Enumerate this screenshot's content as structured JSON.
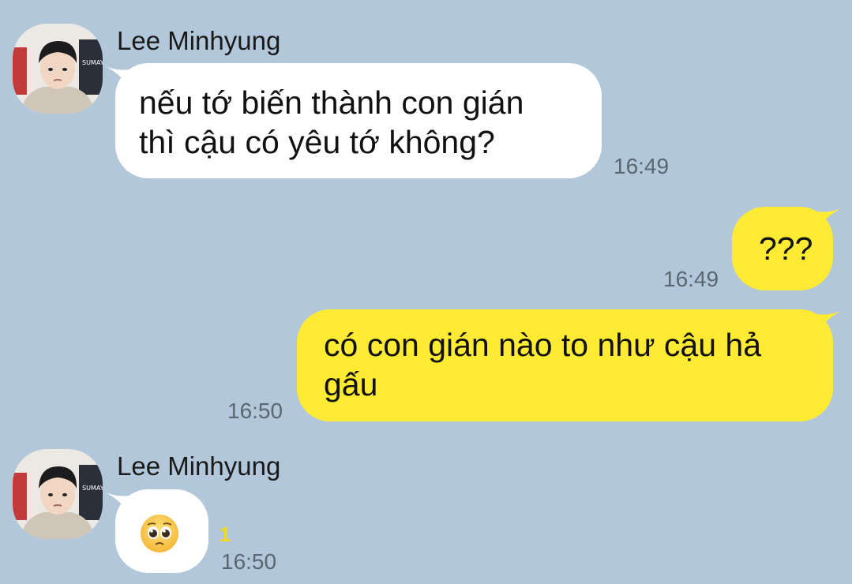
{
  "colors": {
    "background": "#b2c7da",
    "incoming_bubble": "#ffffff",
    "outgoing_bubble": "#ffeb33",
    "unread_count": "#f6d91c"
  },
  "messages": [
    {
      "direction": "incoming",
      "sender": "Lee Minhyung",
      "avatar": "profile-photo",
      "text": "nếu tớ biến thành con gián\nthì cậu có yêu tớ không?",
      "time": "16:49"
    },
    {
      "direction": "outgoing",
      "text": "???",
      "time": "16:49"
    },
    {
      "direction": "outgoing",
      "text": "có con gián nào to như cậu hả\ngấu",
      "time": "16:50"
    },
    {
      "direction": "incoming",
      "sender": "Lee Minhyung",
      "avatar": "profile-photo",
      "emoji": "pleading-face-emoji",
      "unread": "1",
      "time": "16:50"
    }
  ]
}
